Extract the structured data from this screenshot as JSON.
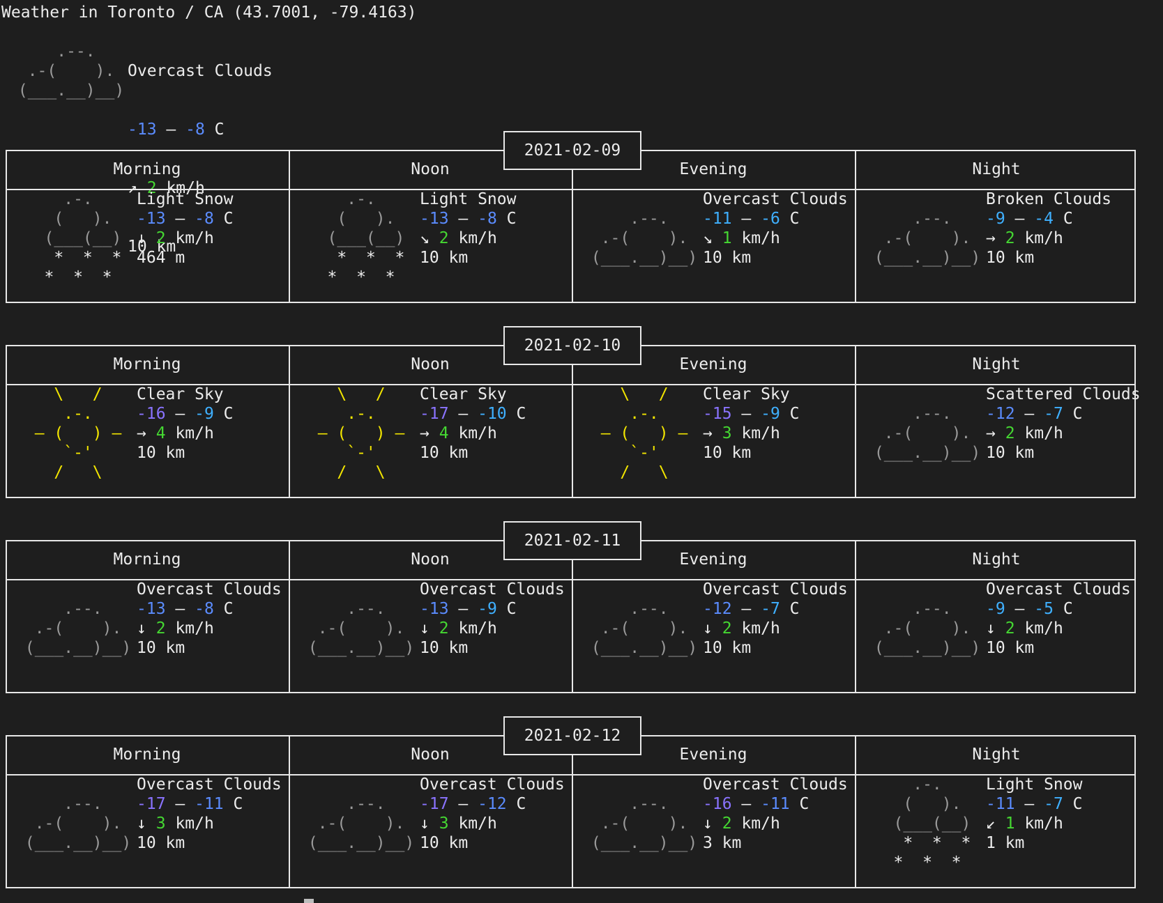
{
  "header": {
    "title": "Weather in Toronto / CA (43.7001, -79.4163)"
  },
  "current": {
    "condition": "Overcast Clouds",
    "temp_low": "-13",
    "temp_high": "-8",
    "temp_unit": "C",
    "wind_dir": "↗",
    "wind_speed": "2",
    "wind_unit": "km/h",
    "visibility": "10 km",
    "icon": "cloud-icon",
    "art": [
      "     .--.    ",
      "  .-(    ).  ",
      " (___.__)__) "
    ]
  },
  "periods": [
    "Morning",
    "Noon",
    "Evening",
    "Night"
  ],
  "days": [
    {
      "date": "2021-02-09",
      "cells": [
        {
          "icon": "snow-icon",
          "condition": "Light Snow",
          "tlo": "-13",
          "thi": "-8",
          "tlo_color": "#5b8cff",
          "thi_color": "#5b8cff",
          "wind_dir": "↓",
          "wind": "2",
          "vis": "464 m"
        },
        {
          "icon": "snow-icon",
          "condition": "Light Snow",
          "tlo": "-13",
          "thi": "-8",
          "tlo_color": "#5b8cff",
          "thi_color": "#5b8cff",
          "wind_dir": "↘",
          "wind": "2",
          "vis": "10 km"
        },
        {
          "icon": "cloud-icon",
          "condition": "Overcast Clouds",
          "tlo": "-11",
          "thi": "-6",
          "tlo_color": "#3fb0ff",
          "thi_color": "#3fb0ff",
          "wind_dir": "↘",
          "wind": "1",
          "vis": "10 km"
        },
        {
          "icon": "cloud-icon",
          "condition": "Broken Clouds",
          "tlo": "-9",
          "thi": "-4",
          "tlo_color": "#3fb0ff",
          "thi_color": "#3fb0ff",
          "wind_dir": "→",
          "wind": "2",
          "vis": "10 km"
        }
      ]
    },
    {
      "date": "2021-02-10",
      "cells": [
        {
          "icon": "sun-icon",
          "condition": "Clear Sky",
          "tlo": "-16",
          "thi": "-9",
          "tlo_color": "#8a73ff",
          "thi_color": "#3fb0ff",
          "wind_dir": "→",
          "wind": "4",
          "vis": "10 km"
        },
        {
          "icon": "sun-icon",
          "condition": "Clear Sky",
          "tlo": "-17",
          "thi": "-10",
          "tlo_color": "#8a73ff",
          "thi_color": "#3fb0ff",
          "wind_dir": "→",
          "wind": "4",
          "vis": "10 km"
        },
        {
          "icon": "sun-icon",
          "condition": "Clear Sky",
          "tlo": "-15",
          "thi": "-9",
          "tlo_color": "#8a73ff",
          "thi_color": "#3fb0ff",
          "wind_dir": "→",
          "wind": "3",
          "vis": "10 km"
        },
        {
          "icon": "cloud-icon",
          "condition": "Scattered Clouds",
          "tlo": "-12",
          "thi": "-7",
          "tlo_color": "#5b8cff",
          "thi_color": "#3fb0ff",
          "wind_dir": "→",
          "wind": "2",
          "vis": "10 km"
        }
      ]
    },
    {
      "date": "2021-02-11",
      "cells": [
        {
          "icon": "cloud-icon",
          "condition": "Overcast Clouds",
          "tlo": "-13",
          "thi": "-8",
          "tlo_color": "#5b8cff",
          "thi_color": "#5b8cff",
          "wind_dir": "↓",
          "wind": "2",
          "vis": "10 km"
        },
        {
          "icon": "cloud-icon",
          "condition": "Overcast Clouds",
          "tlo": "-13",
          "thi": "-9",
          "tlo_color": "#5b8cff",
          "thi_color": "#3fb0ff",
          "wind_dir": "↓",
          "wind": "2",
          "vis": "10 km"
        },
        {
          "icon": "cloud-icon",
          "condition": "Overcast Clouds",
          "tlo": "-12",
          "thi": "-7",
          "tlo_color": "#5b8cff",
          "thi_color": "#3fb0ff",
          "wind_dir": "↓",
          "wind": "2",
          "vis": "10 km"
        },
        {
          "icon": "cloud-icon",
          "condition": "Overcast Clouds",
          "tlo": "-9",
          "thi": "-5",
          "tlo_color": "#3fb0ff",
          "thi_color": "#3fb0ff",
          "wind_dir": "↓",
          "wind": "2",
          "vis": "10 km"
        }
      ]
    },
    {
      "date": "2021-02-12",
      "cells": [
        {
          "icon": "cloud-icon",
          "condition": "Overcast Clouds",
          "tlo": "-17",
          "thi": "-11",
          "tlo_color": "#8a73ff",
          "thi_color": "#5b8cff",
          "wind_dir": "↓",
          "wind": "3",
          "vis": "10 km"
        },
        {
          "icon": "cloud-icon",
          "condition": "Overcast Clouds",
          "tlo": "-17",
          "thi": "-12",
          "tlo_color": "#8a73ff",
          "thi_color": "#5b8cff",
          "wind_dir": "↓",
          "wind": "3",
          "vis": "10 km"
        },
        {
          "icon": "cloud-icon",
          "condition": "Overcast Clouds",
          "tlo": "-16",
          "thi": "-11",
          "tlo_color": "#8a73ff",
          "thi_color": "#5b8cff",
          "wind_dir": "↓",
          "wind": "2",
          "vis": "3 km"
        },
        {
          "icon": "snow-icon",
          "condition": "Light Snow",
          "tlo": "-11",
          "thi": "-7",
          "tlo_color": "#5b8cff",
          "thi_color": "#3fb0ff",
          "wind_dir": "↙",
          "wind": "1",
          "vis": "1 km"
        }
      ]
    }
  ],
  "units": {
    "temp": "C",
    "wind": "km/h"
  },
  "colors": {
    "background": "#1e1e1e",
    "text": "#ececec",
    "wind_speed": "#45d832",
    "sun": "#f3e600",
    "cloud": "#9a9a9a"
  },
  "art": {
    "snow-icon": [
      {
        "lines": [
          "     .-.    ",
          "    (   ).  ",
          "   (___(__) "
        ],
        "color": "#9a9a9a"
      },
      {
        "lines": [
          "    *  *  *  ",
          "   *  *  *   "
        ],
        "color": "#ececec"
      }
    ],
    "cloud-icon": [
      {
        "lines": [
          "",
          "     .--.    ",
          "  .-(    ).  ",
          " (___.__)__) "
        ],
        "color": "#9a9a9a"
      }
    ],
    "sun-icon": [
      {
        "lines": [
          "    \\   /    ",
          "     .-.     ",
          "  ‒ (   ) ‒  ",
          "     `-'     ",
          "    /   \\    "
        ],
        "color": "#f3e600"
      }
    ]
  }
}
